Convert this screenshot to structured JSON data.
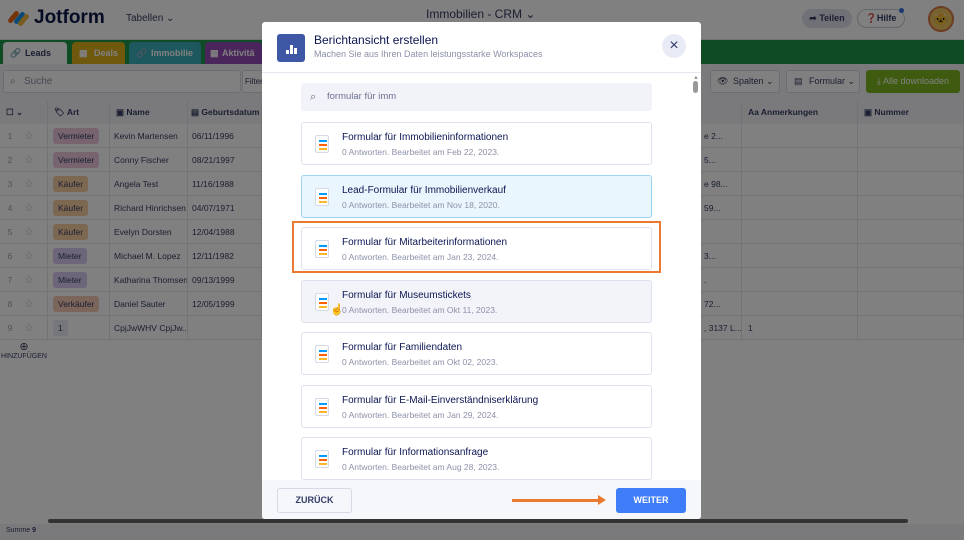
{
  "app": {
    "brand": "Jotform",
    "tables_menu": "Tabellen",
    "title": "Immobilien - CRM",
    "share": "Teilen",
    "help": "Hilfe"
  },
  "tabs": [
    {
      "label": "Leads",
      "color": "#ffffff"
    },
    {
      "label": "Deals",
      "color": "#e9b200"
    },
    {
      "label": "Immobilie",
      "color": "#2bb5c4"
    },
    {
      "label": "Aktivitä",
      "color": "#9c46c8"
    }
  ],
  "toolbar": {
    "search_placeholder": "Suche",
    "filter": "Filter",
    "columns": "Spalten",
    "form": "Formular",
    "download_all": "Alle downloaden"
  },
  "table": {
    "headers": [
      "Art",
      "Name",
      "Geburtsdatum",
      "Anmerkungen",
      "Nummer"
    ],
    "rows": [
      {
        "n": "1",
        "art": "Vermieter",
        "name": "Kevin Martensen",
        "date": "06/11/1996",
        "addr": "e 2...",
        "note": "",
        "num": ""
      },
      {
        "n": "2",
        "art": "Vermieter",
        "name": "Conny Fischer",
        "date": "08/21/1997",
        "addr": "5...",
        "note": "",
        "num": ""
      },
      {
        "n": "3",
        "art": "Käufer",
        "name": "Angela Test",
        "date": "11/16/1988",
        "addr": "e 98...",
        "note": "",
        "num": ""
      },
      {
        "n": "4",
        "art": "Käufer",
        "name": "Richard Hinrichsen",
        "date": "04/07/1971",
        "addr": "59...",
        "note": "",
        "num": ""
      },
      {
        "n": "5",
        "art": "Käufer",
        "name": "Evelyn Dorsten",
        "date": "12/04/1988",
        "addr": "",
        "note": "",
        "num": ""
      },
      {
        "n": "6",
        "art": "Mieter",
        "name": "Michael M. Lopez",
        "date": "12/11/1982",
        "addr": "3...",
        "note": "",
        "num": ""
      },
      {
        "n": "7",
        "art": "Mieter",
        "name": "Katharina Thomsen",
        "date": "09/13/1999",
        "addr": ".",
        "note": "",
        "num": ""
      },
      {
        "n": "8",
        "art": "Verkäufer",
        "name": "Daniel Sauter",
        "date": "12/05/1999",
        "addr": "72...",
        "note": "",
        "num": ""
      },
      {
        "n": "9",
        "art": "1",
        "name": "CpjJwWHV CpjJw...",
        "date": "",
        "addr": ", 3137 L...",
        "note": "1",
        "num": ""
      }
    ],
    "add_label": "HINZUFÜGEN",
    "sum_label": "Summe",
    "sum_value": "9"
  },
  "art_colors": {
    "Vermieter": "#f3c6e0",
    "Käufer": "#ffcf96",
    "Mieter": "#dccafc",
    "Verkäufer": "#ffc9b0",
    "1": "#eceef5"
  },
  "modal": {
    "title": "Berichtansicht erstellen",
    "subtitle": "Machen Sie aus Ihren Daten leistungsstarke Workspaces",
    "search_value": "formular für imm",
    "forms": [
      {
        "title": "Formular für Immobilieninformationen",
        "meta": "0 Antworten. Bearbeitet am Feb 22, 2023."
      },
      {
        "title": "Lead-Formular für Immobilienverkauf",
        "meta": "0 Antworten. Bearbeitet am Nov 18, 2020.",
        "selected": true
      },
      {
        "title": "Formular für Mitarbeiterinformationen",
        "meta": "0 Antworten. Bearbeitet am Jan 23, 2024."
      },
      {
        "title": "Formular für Museumstickets",
        "meta": "0 Antworten. Bearbeitet am Okt 11, 2023."
      },
      {
        "title": "Formular für Familiendaten",
        "meta": "0 Antworten. Bearbeitet am Okt 02, 2023."
      },
      {
        "title": "Formular für E-Mail-Einverständniserklärung",
        "meta": "0 Antworten. Bearbeitet am Jan 29, 2024."
      },
      {
        "title": "Formular für Informationsanfrage",
        "meta": "0 Antworten. Bearbeitet am Aug 28, 2023."
      }
    ],
    "back": "ZURÜCK",
    "next": "WEITER"
  },
  "accent": {
    "highlight": "#ea7a2f",
    "primary": "#3f7cf7",
    "brand_green": "#0f9d45"
  }
}
